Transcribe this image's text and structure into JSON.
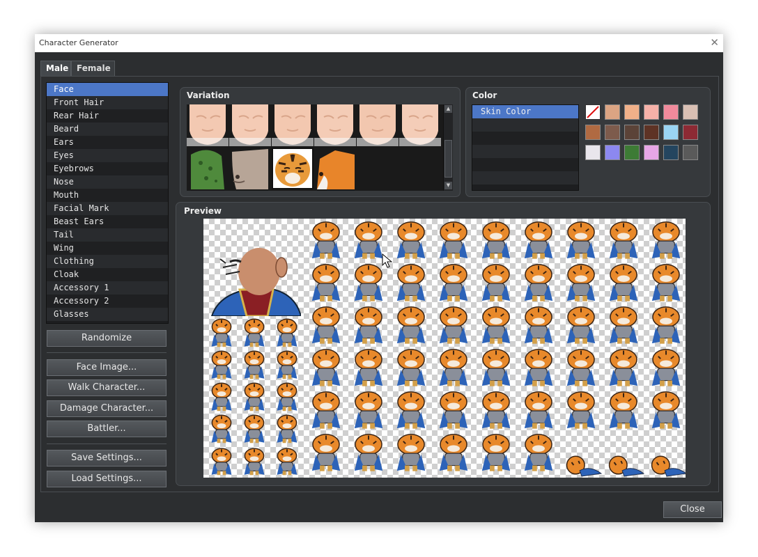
{
  "window": {
    "title": "Character Generator",
    "close_glyph": "✕"
  },
  "tabs": [
    {
      "label": "Male"
    },
    {
      "label": "Female"
    }
  ],
  "parts": {
    "selected_index": 0,
    "items": [
      "Face",
      "Front Hair",
      "Rear Hair",
      "Beard",
      "Ears",
      "Eyes",
      "Eyebrows",
      "Nose",
      "Mouth",
      "Facial Mark",
      "Beast Ears",
      "Tail",
      "Wing",
      "Clothing",
      "Cloak",
      "Accessory 1",
      "Accessory 2",
      "Glasses"
    ]
  },
  "buttons": {
    "randomize": "Randomize",
    "face_image": "Face Image...",
    "walk_character": "Walk Character...",
    "damage_character": "Damage Character...",
    "battler": "Battler...",
    "save_settings": "Save Settings...",
    "load_settings": "Load Settings...",
    "close": "Close"
  },
  "variation": {
    "title": "Variation",
    "selected_index": 8,
    "items": [
      {
        "kind": "human-face",
        "color": "#f3c9b2"
      },
      {
        "kind": "human-face",
        "color": "#f4cbb5"
      },
      {
        "kind": "human-face",
        "color": "#f3c8b0"
      },
      {
        "kind": "human-face",
        "color": "#f4ccb6"
      },
      {
        "kind": "human-face",
        "color": "#f2c7af"
      },
      {
        "kind": "human-face",
        "color": "#f4cdb8"
      },
      {
        "kind": "lizard-face",
        "color": "#4f8a3c"
      },
      {
        "kind": "beast-face",
        "color": "#b7a597"
      },
      {
        "kind": "tiger-face",
        "color": "#e89a3a"
      },
      {
        "kind": "fox-face",
        "color": "#e8852a"
      }
    ]
  },
  "color": {
    "title": "Color",
    "selected_index": 0,
    "items": [
      "Skin Color"
    ],
    "empty_rows": 5,
    "swatches": [
      "none",
      "#dba483",
      "#f0b089",
      "#f6b1a8",
      "#f08a9c",
      "#d9c0b4",
      "#b06a42",
      "#7d5b4c",
      "#5b4338",
      "#5e3325",
      "#9ad4f3",
      "#8d2a34",
      "#e9e6ec",
      "#8c88f0",
      "#3d7b35",
      "#e6a6e6",
      "#24455f",
      "#5a5a5a"
    ]
  },
  "preview": {
    "title": "Preview",
    "face_skin": "#c98e6d",
    "cloak": "#2d63b8",
    "tiger": "#e8892b"
  }
}
